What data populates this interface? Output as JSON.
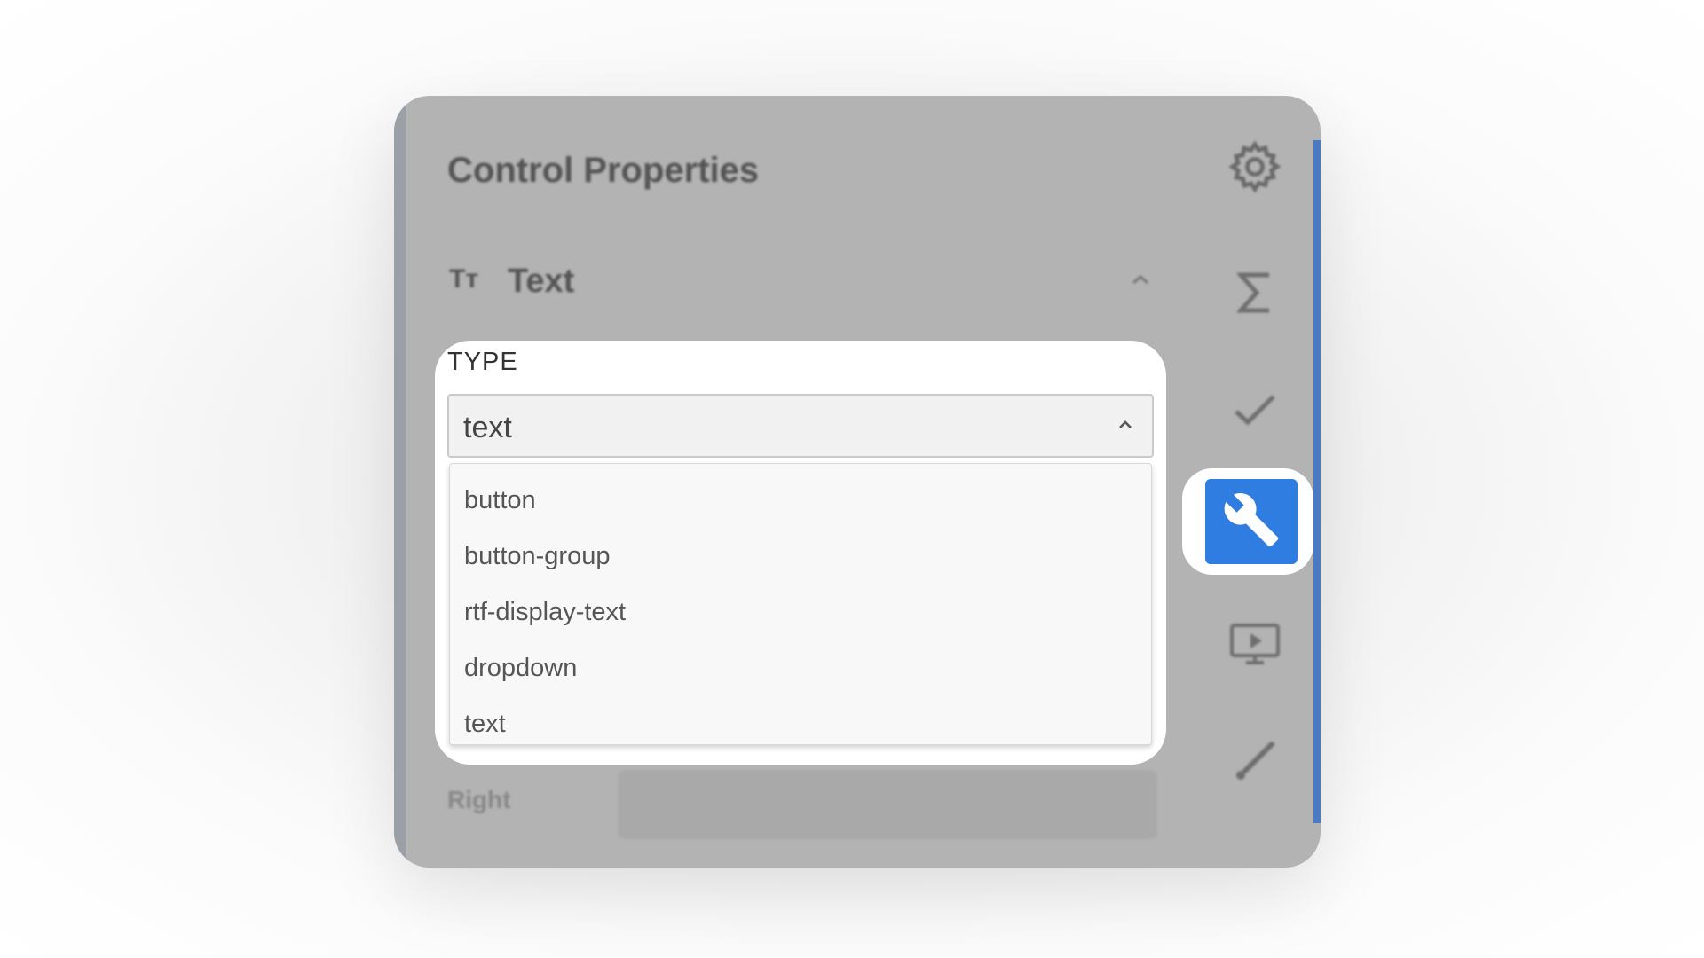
{
  "panel": {
    "title": "Control Properties",
    "section": {
      "icon": "text-format-icon",
      "icon_glyph": "Tт",
      "title": "Text"
    },
    "right_field_label": "Right"
  },
  "type_field": {
    "label": "TYPE",
    "selected_value": "text",
    "options": [
      "button",
      "button-group",
      "rtf-display-text",
      "dropdown",
      "text"
    ]
  },
  "side_rail": {
    "icons": [
      "gear-icon",
      "sigma-icon",
      "checkmark-icon",
      "wrench-icon",
      "play-screen-icon",
      "brush-icon"
    ],
    "active": "wrench-icon"
  },
  "colors": {
    "accent": "#2f7de1",
    "panel_overlay": "#b3b3b3"
  }
}
